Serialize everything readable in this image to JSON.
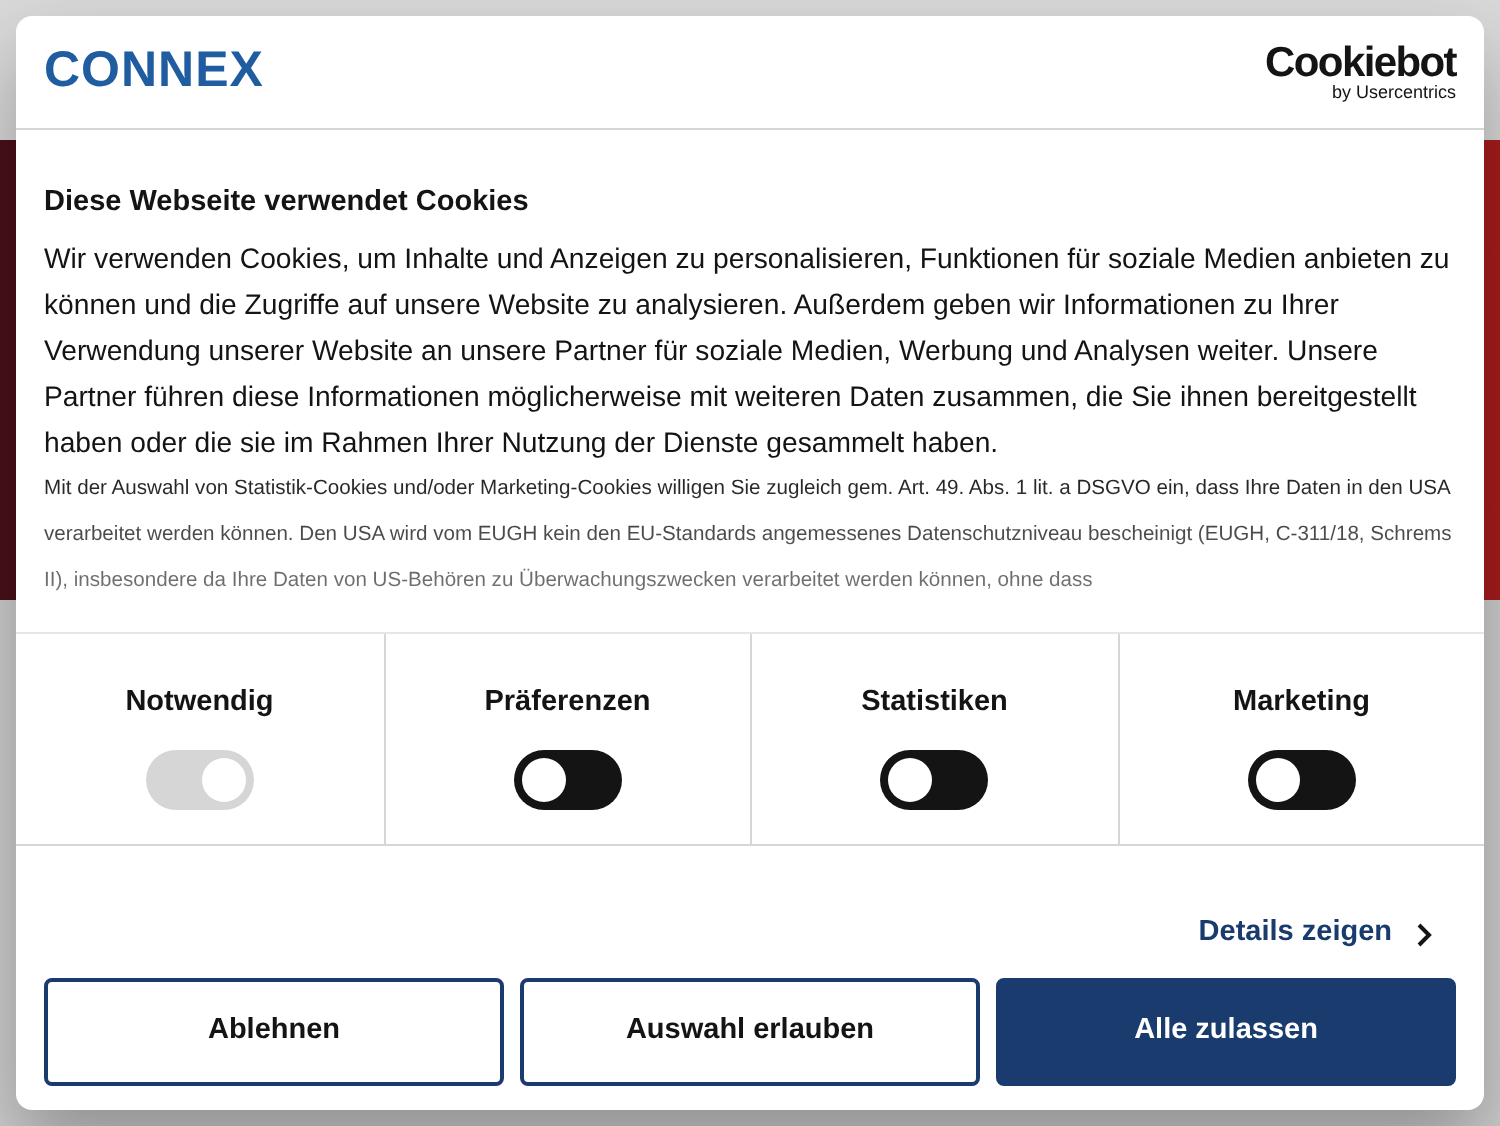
{
  "dialog": {
    "brand": "CONNEX",
    "provider": {
      "name": "Cookiebot",
      "byline": "by Usercentrics"
    },
    "title": "Diese Webseite verwendet Cookies",
    "text": "Wir verwenden Cookies, um Inhalte und Anzeigen zu personalisieren, Funktionen für soziale Medien anbieten zu können und die Zugriffe auf unsere Website zu analysieren. Außerdem geben wir Informationen zu Ihrer Verwendung unserer Website an unsere Partner für soziale Medien, Werbung und Analysen weiter. Unsere Partner führen diese Informationen möglicherweise mit weiteren Daten zusammen, die Sie ihnen bereitgestellt haben oder die sie im Rahmen Ihrer Nutzung der Dienste gesammelt haben.",
    "notice": "Mit der Auswahl von Statistik-Cookies und/oder Marketing-Cookies willigen Sie zugleich gem. Art. 49. Abs. 1 lit. a DSGVO ein, dass Ihre Daten in den USA verarbeitet werden können. Den USA wird vom EUGH kein den EU-Standards angemessenes Datenschutzniveau bescheinigt (EUGH, C-311/18, Schrems II), insbesondere da Ihre Daten von US-Behören zu Überwachungszwecken verarbeitet werden können, ohne dass",
    "categories": [
      {
        "label": "Notwendig",
        "on": true,
        "disabled": true
      },
      {
        "label": "Präferenzen",
        "on": false,
        "disabled": false
      },
      {
        "label": "Statistiken",
        "on": false,
        "disabled": false
      },
      {
        "label": "Marketing",
        "on": false,
        "disabled": false
      }
    ],
    "details_link": "Details zeigen",
    "buttons": [
      {
        "label": "Ablehnen",
        "kind": "outline"
      },
      {
        "label": "Auswahl erlauben",
        "kind": "outline"
      },
      {
        "label": "Alle zulassen",
        "kind": "primary"
      }
    ]
  }
}
